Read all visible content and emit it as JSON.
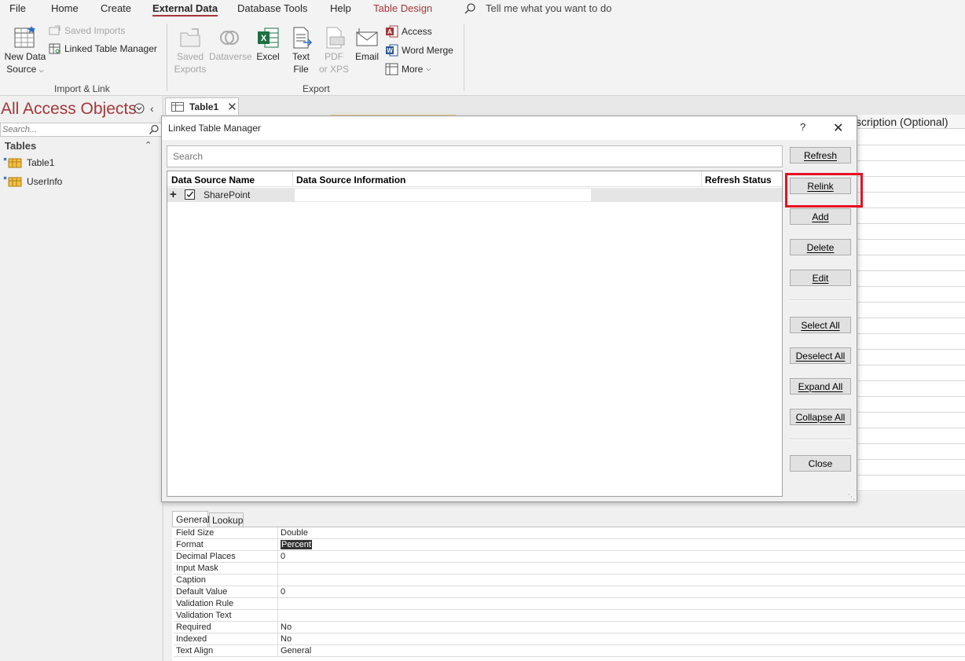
{
  "menu": {
    "tabs": [
      "File",
      "Home",
      "Create",
      "External Data",
      "Database Tools",
      "Help",
      "Table Design"
    ],
    "tell_me": "Tell me what you want to do"
  },
  "ribbon": {
    "new_data_source": [
      "New Data",
      "Source"
    ],
    "saved_imports": "Saved Imports",
    "linked_table_manager": "Linked Table Manager",
    "import_link_label": "Import & Link",
    "saved_exports": [
      "Saved",
      "Exports"
    ],
    "dataverse": "Dataverse",
    "excel": "Excel",
    "text_file": [
      "Text",
      "File"
    ],
    "pdf_xps": [
      "PDF",
      "or XPS"
    ],
    "email": "Email",
    "access": "Access",
    "word_merge": "Word Merge",
    "more": "More",
    "export_label": "Export"
  },
  "nav": {
    "title": "All Access Objects",
    "search_placeholder": "Search...",
    "section": "Tables",
    "items": [
      "Table1",
      "UserInfo"
    ]
  },
  "doc_tab": {
    "label": "Table1"
  },
  "design_header": {
    "description": "scription (Optional)"
  },
  "dialog": {
    "title": "Linked Table Manager",
    "help": "?",
    "search_placeholder": "Search",
    "columns": [
      "Data Source Name",
      "Data Source Information",
      "Refresh Status"
    ],
    "rows": [
      {
        "name": "SharePoint",
        "info": "",
        "status": ""
      }
    ],
    "buttons": {
      "refresh": "Refresh",
      "relink": "Relink",
      "add": "Add",
      "delete": "Delete",
      "edit": "Edit",
      "select_all": "Select All",
      "deselect_all": "Deselect All",
      "expand_all": "Expand All",
      "collapse_all": "Collapse All",
      "close": "Close"
    }
  },
  "properties": {
    "tabs": [
      "General",
      "Lookup"
    ],
    "rows": [
      {
        "name": "Field Size",
        "value": "Double"
      },
      {
        "name": "Format",
        "value": "Percent"
      },
      {
        "name": "Decimal Places",
        "value": "0"
      },
      {
        "name": "Input Mask",
        "value": ""
      },
      {
        "name": "Caption",
        "value": ""
      },
      {
        "name": "Default Value",
        "value": "0"
      },
      {
        "name": "Validation Rule",
        "value": ""
      },
      {
        "name": "Validation Text",
        "value": ""
      },
      {
        "name": "Required",
        "value": "No"
      },
      {
        "name": "Indexed",
        "value": "No"
      },
      {
        "name": "Text Align",
        "value": "General"
      }
    ]
  },
  "colors": {
    "accent": "#a4373a",
    "highlight": "#e81123",
    "selection": "#333333"
  }
}
